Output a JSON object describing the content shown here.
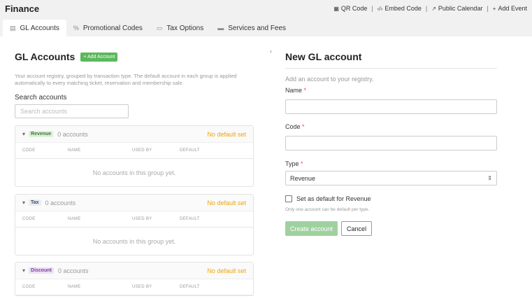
{
  "app": {
    "title": "Finance"
  },
  "toplinks": [
    {
      "icon": "qr-icon",
      "glyph": "▦",
      "label": "QR Code"
    },
    {
      "icon": "code-icon",
      "glyph": "‹/›",
      "label": "Embed Code"
    },
    {
      "icon": "external-link-icon",
      "glyph": "↗",
      "label": "Public Calendar"
    },
    {
      "icon": "plus-icon",
      "glyph": "+",
      "label": "Add Event"
    }
  ],
  "separator": "|",
  "tabs": [
    {
      "icon": "book-icon",
      "glyph": "▤",
      "label": "GL Accounts",
      "active": true
    },
    {
      "icon": "percent-icon",
      "glyph": "%",
      "label": "Promotional Codes",
      "active": false
    },
    {
      "icon": "ticket-icon",
      "glyph": "▭",
      "label": "Tax Options",
      "active": false
    },
    {
      "icon": "money-icon",
      "glyph": "▬",
      "label": "Services and Fees",
      "active": false
    }
  ],
  "left": {
    "title": "GL Accounts",
    "add_label": "+ Add Account",
    "description": "Your account registry, grouped by transaction type. The default account in each group is applied automatically to every matching ticket, reservation and membership sale.",
    "search_label": "Search accounts",
    "search_placeholder": "Search accounts"
  },
  "columns": [
    "CODE",
    "NAME",
    "USED BY",
    "DEFAULT"
  ],
  "groups": [
    {
      "badge": "Revenue",
      "badge_bg": "#dff0d8",
      "badge_fg": "#3c763d",
      "count": "0 accounts",
      "default_text": "No default set",
      "empty_text": "No accounts in this group yet."
    },
    {
      "badge": "Tax",
      "badge_bg": "#e8edf3",
      "badge_fg": "#3a4a5c",
      "count": "0 accounts",
      "default_text": "No default set",
      "empty_text": "No accounts in this group yet."
    },
    {
      "badge": "Discount",
      "badge_bg": "#ede1f5",
      "badge_fg": "#7b3fa0",
      "count": "0 accounts",
      "default_text": "No default set",
      "empty_text": ""
    }
  ],
  "collapse_glyph": "‹",
  "form": {
    "title": "New GL account",
    "subtitle": "Add an account to your registry.",
    "name_label": "Name",
    "code_label": "Code",
    "type_label": "Type",
    "required_mark": "*",
    "type_value": "Revenue",
    "select_glyph": "⇕",
    "checkbox_label": "Set as default for Revenue",
    "hint": "Only one account can be default per type.",
    "create_label": "Create account",
    "cancel_label": "Cancel"
  }
}
